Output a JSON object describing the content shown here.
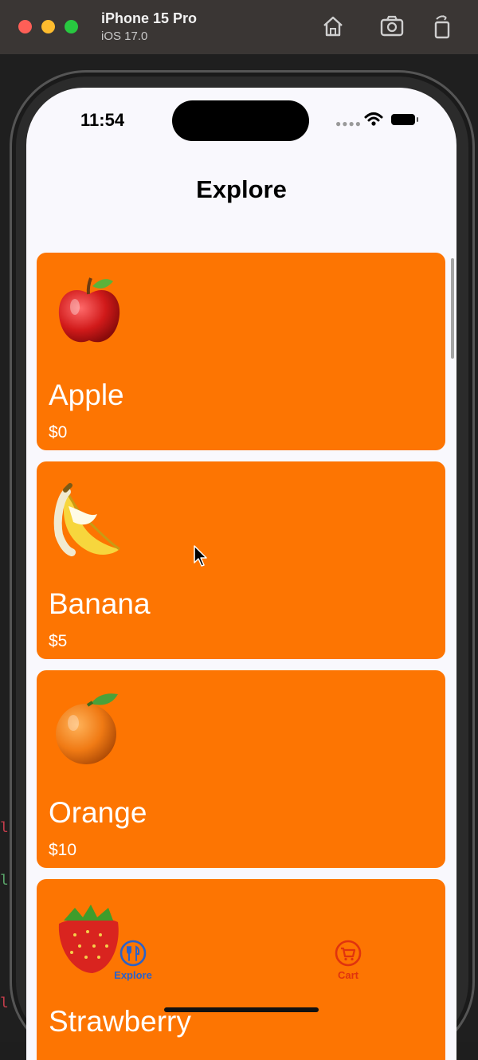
{
  "simulator": {
    "device_name": "iPhone 15 Pro",
    "os_version": "iOS 17.0",
    "buttons": [
      "home-icon",
      "screenshot-icon",
      "rotate-icon"
    ]
  },
  "status_bar": {
    "time": "11:54"
  },
  "nav": {
    "title": "Explore"
  },
  "products": [
    {
      "name": "Apple",
      "price": "$0",
      "emoji": "apple"
    },
    {
      "name": "Banana",
      "price": "$5",
      "emoji": "banana"
    },
    {
      "name": "Orange",
      "price": "$10",
      "emoji": "orange"
    },
    {
      "name": "Strawberry",
      "price": "",
      "emoji": "strawberry"
    }
  ],
  "tabbar": {
    "explore_label": "Explore",
    "cart_label": "Cart"
  },
  "colors": {
    "card": "#fd7502",
    "explore_tab": "#2b62c9",
    "cart_tab": "#e0330e"
  }
}
